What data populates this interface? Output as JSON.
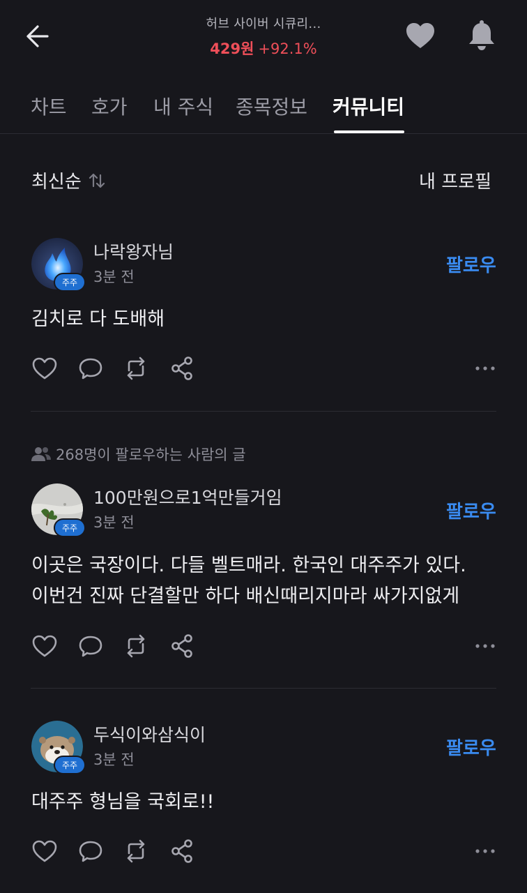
{
  "header": {
    "stock_name": "허브 사이버 시큐리...",
    "price": "429원",
    "change": "+92.1%",
    "accent_up_color": "#ef4f59"
  },
  "tabs": [
    {
      "label": "차트"
    },
    {
      "label": "호가"
    },
    {
      "label": "내 주식"
    },
    {
      "label": "종목정보"
    },
    {
      "label": "커뮤니티",
      "active": true
    }
  ],
  "sort": {
    "label": "최신순",
    "profile_label": "내 프로필"
  },
  "posts": [
    {
      "author": "나락왕자님",
      "time": "3분 전",
      "badge": "주주",
      "follow_label": "팔로우",
      "body_lines": [
        "김치로 다 도배해"
      ]
    },
    {
      "meta": "268명이 팔로우하는 사람의 글",
      "author": "100만원으로1억만들거임",
      "time": "3분 전",
      "badge": "주주",
      "follow_label": "팔로우",
      "body_lines": [
        "이곳은 국장이다. 다들 벨트매라. 한국인 대주주가 있다.",
        "이번건 진짜 단결할만 하다 배신때리지마라 싸가지없게"
      ]
    },
    {
      "author": "두식이와삼식이",
      "time": "3분 전",
      "badge": "주주",
      "follow_label": "팔로우",
      "body_lines": [
        "대주주 형님을 국회로!!"
      ]
    }
  ],
  "icons": {
    "back": "arrow-left-icon",
    "heart": "heart-icon",
    "bell": "bell-icon",
    "sort": "sort-arrows-icon",
    "like": "heart-outline-icon",
    "comment": "comment-icon",
    "repost": "repost-icon",
    "share": "share-icon",
    "more": "more-dots-icon",
    "followers": "people-icon"
  },
  "colors": {
    "background": "#17171c",
    "follow": "#3a8bf0",
    "badge": "#1f6fd1"
  }
}
